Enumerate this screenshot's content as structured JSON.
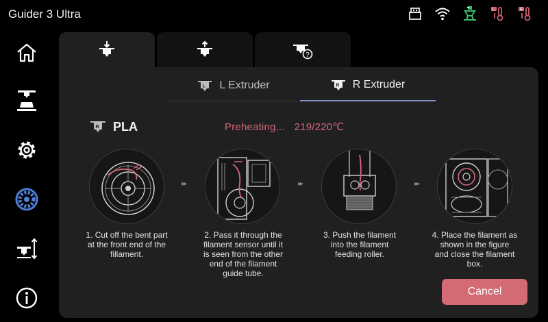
{
  "app": {
    "title": "Guider 3 Ultra"
  },
  "status_icons": [
    "usb-icon",
    "wifi-icon",
    "left-nozzle-temp-icon",
    "right-nozzle-temp-icon",
    "bed-temp-icon"
  ],
  "sidebar": {
    "items": [
      {
        "name": "home",
        "icon": "home-icon"
      },
      {
        "name": "print",
        "icon": "print-icon"
      },
      {
        "name": "settings",
        "icon": "gear-icon"
      },
      {
        "name": "filament",
        "icon": "filament-spool-icon",
        "active": true
      },
      {
        "name": "calibrate",
        "icon": "level-icon"
      },
      {
        "name": "info",
        "icon": "info-icon"
      }
    ]
  },
  "top_tabs": [
    {
      "icon": "load-filament-icon",
      "active": true
    },
    {
      "icon": "unload-filament-icon",
      "active": false
    },
    {
      "icon": "filament-help-icon",
      "active": false
    }
  ],
  "extruder_tabs": {
    "left": {
      "label": "L Extruder",
      "badge": "L"
    },
    "right": {
      "label": "R Extruder",
      "badge": "R",
      "active": true
    }
  },
  "material": {
    "badge": "R",
    "name": "PLA"
  },
  "heating": {
    "status": "Preheating...",
    "temp": "219/220℃"
  },
  "steps": [
    {
      "caption_lines": [
        "1. Cut off the bent part",
        "at the front end of the",
        "fillament."
      ]
    },
    {
      "caption_lines": [
        "2. Pass it through the",
        "filament sensor until it",
        "is seen from the other",
        "end of the filament",
        "guide tube."
      ]
    },
    {
      "caption_lines": [
        "3. Push the filament",
        "into the filament",
        "feeding roller."
      ]
    },
    {
      "caption_lines": [
        "4. Place the filament as",
        "shown in the figure",
        "and close the filament",
        "box."
      ]
    }
  ],
  "arrow": "▸▸",
  "cancel_label": "Cancel",
  "colors": {
    "accent_pink": "#d46a76",
    "tab_underline": "#7d93c8",
    "active_nav": "#4f7fd6",
    "temp_icon_red": "#d0606e",
    "temp_icon_green": "#3bbf6a"
  }
}
